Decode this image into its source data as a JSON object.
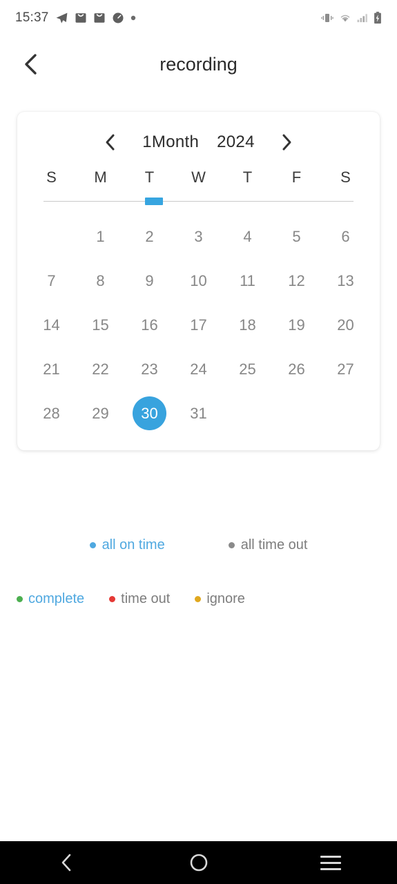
{
  "status_bar": {
    "time": "15:37",
    "left_icons": [
      "telegram-icon",
      "mail-icon",
      "mail-icon",
      "speedometer-icon",
      "dot-icon"
    ],
    "right_icons": [
      "vibrate-icon",
      "wifi-icon",
      "signal-icon",
      "battery-charging-icon"
    ]
  },
  "header": {
    "back_icon": "chevron-left-icon",
    "title": "recording"
  },
  "calendar": {
    "prev_icon": "chevron-left-icon",
    "next_icon": "chevron-right-icon",
    "month_label": "1Month",
    "year_label": "2024",
    "weekdays": [
      "S",
      "M",
      "T",
      "W",
      "T",
      "F",
      "S"
    ],
    "indicator_column": 2,
    "selected_day": "30",
    "weeks": [
      [
        "",
        "1",
        "2",
        "3",
        "4",
        "5",
        "6"
      ],
      [
        "7",
        "8",
        "9",
        "10",
        "11",
        "12",
        "13"
      ],
      [
        "14",
        "15",
        "16",
        "17",
        "18",
        "19",
        "20"
      ],
      [
        "21",
        "22",
        "23",
        "24",
        "25",
        "26",
        "27"
      ],
      [
        "28",
        "29",
        "30",
        "31",
        "",
        "",
        ""
      ]
    ]
  },
  "filters": [
    {
      "label": "all on time",
      "color": "#4fa8e0",
      "active": true
    },
    {
      "label": "all time out",
      "color": "#8a8a8a",
      "active": false
    }
  ],
  "legend": [
    {
      "label": "complete",
      "color": "#4caf50",
      "highlight": true
    },
    {
      "label": "time out",
      "color": "#e53935",
      "highlight": false
    },
    {
      "label": "ignore",
      "color": "#e0a81f",
      "highlight": false
    }
  ],
  "nav_bar": {
    "back_icon": "chevron-left-icon",
    "home_icon": "circle-icon",
    "recents_icon": "hamburger-icon"
  },
  "colors": {
    "accent_blue": "#38a3de",
    "link_blue": "#4fa8e0",
    "muted_gray": "#878787"
  }
}
